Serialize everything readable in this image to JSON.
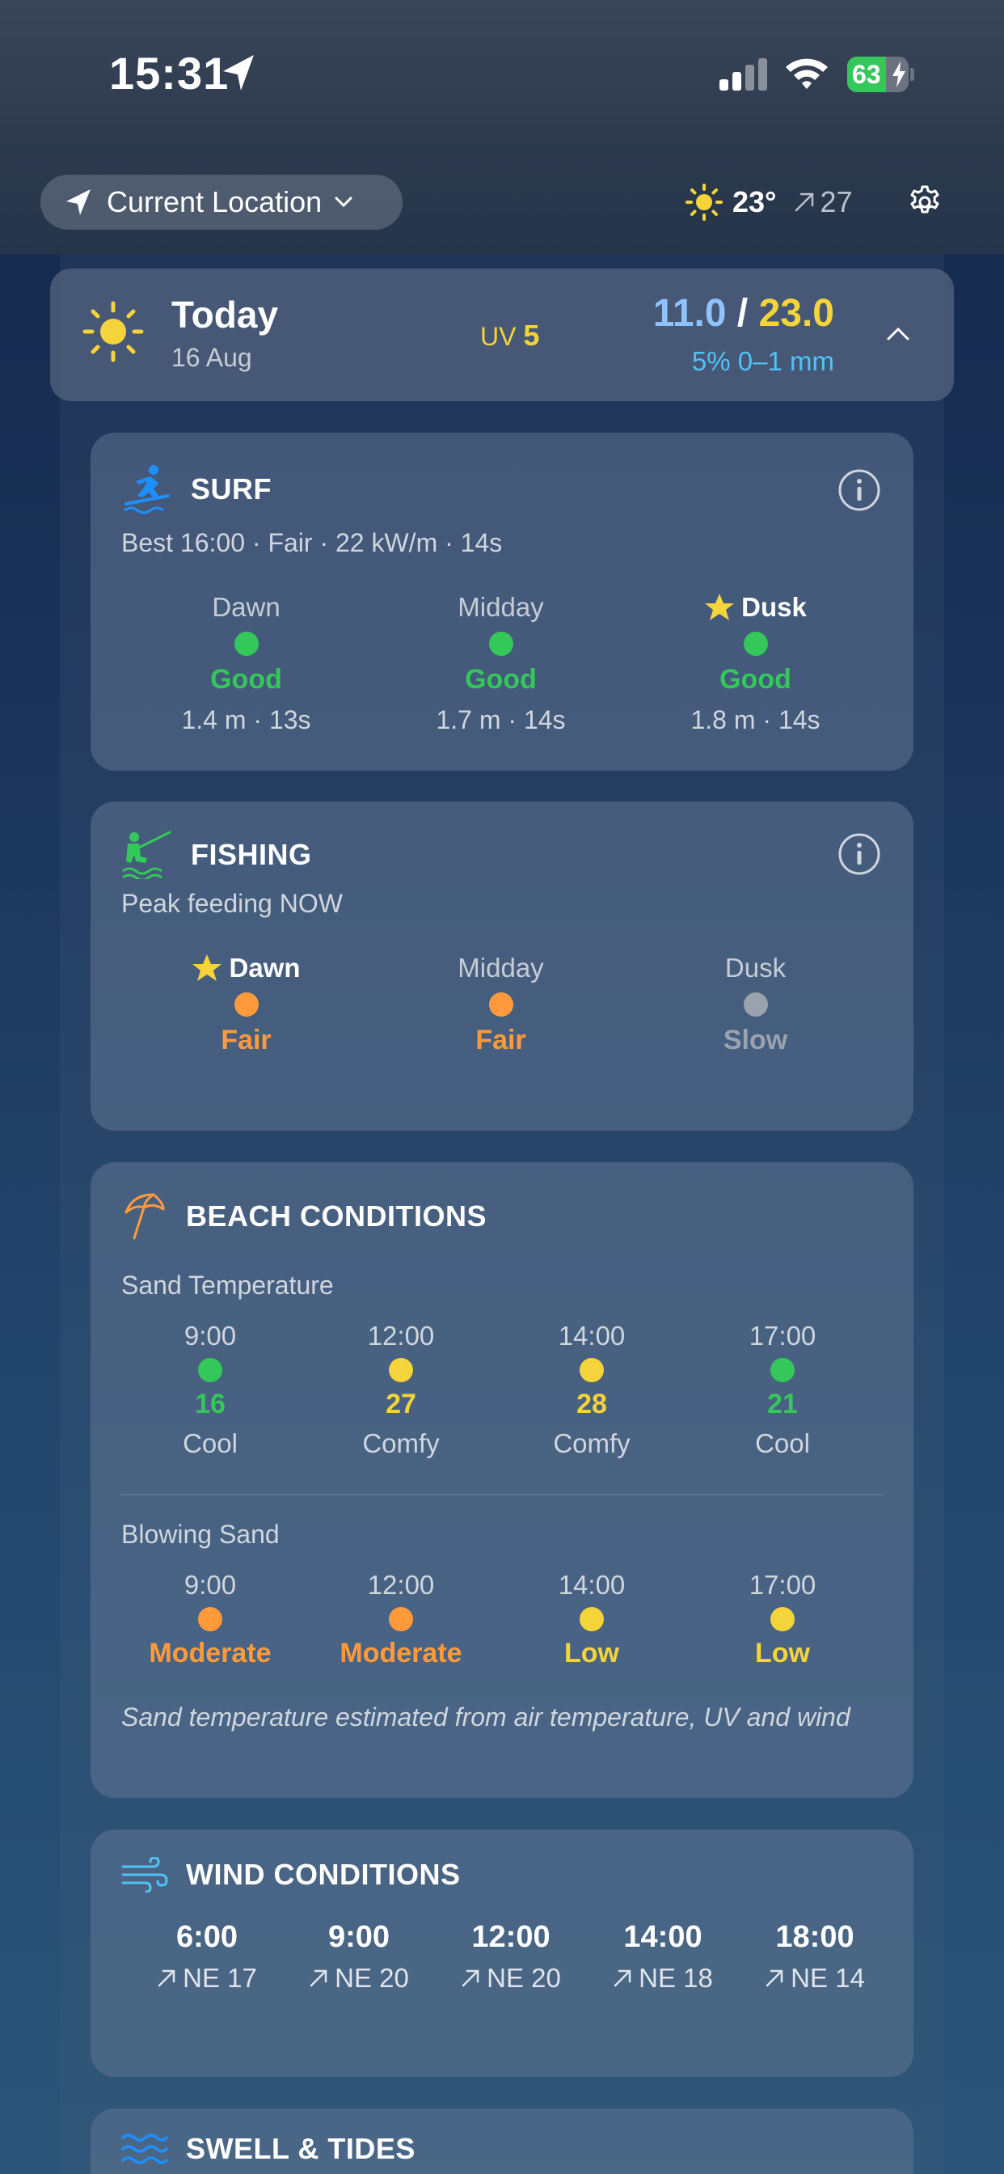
{
  "status_bar": {
    "time": "15:31",
    "battery": "63",
    "battery_level": 0.63
  },
  "header": {
    "location_label": "Current Location",
    "temperature": "23°",
    "wind_speed": "27"
  },
  "today": {
    "title": "Today",
    "date": "16 Aug",
    "uv_label": "UV",
    "uv_value": "5",
    "temp_low": "11.0",
    "temp_sep": "/",
    "temp_high": "23.0",
    "rain": "5% 0–1 mm"
  },
  "surf": {
    "title": "SURF",
    "summary": "Best 16:00 · Fair · 22 kW/m · 14s",
    "periods": [
      {
        "name": "Dawn",
        "starred": false,
        "rating": "Good",
        "color": "#34c759",
        "detail": "1.4 m · 13s"
      },
      {
        "name": "Midday",
        "starred": false,
        "rating": "Good",
        "color": "#34c759",
        "detail": "1.7 m · 14s"
      },
      {
        "name": "Dusk",
        "starred": true,
        "rating": "Good",
        "color": "#34c759",
        "detail": "1.8 m · 14s"
      }
    ]
  },
  "fishing": {
    "title": "FISHING",
    "summary": "Peak feeding NOW",
    "periods": [
      {
        "name": "Dawn",
        "starred": true,
        "rating": "Fair",
        "color": "#ff9a3c"
      },
      {
        "name": "Midday",
        "starred": false,
        "rating": "Fair",
        "color": "#ff9a3c"
      },
      {
        "name": "Dusk",
        "starred": false,
        "rating": "Slow",
        "color": "#9aa2ae"
      }
    ]
  },
  "beach": {
    "title": "BEACH CONDITIONS",
    "sand_temp_label": "Sand Temperature",
    "sand_temps": [
      {
        "time": "9:00",
        "value": "16",
        "desc": "Cool",
        "color": "#34c759"
      },
      {
        "time": "12:00",
        "value": "27",
        "desc": "Comfy",
        "color": "#f5d33a"
      },
      {
        "time": "14:00",
        "value": "28",
        "desc": "Comfy",
        "color": "#f5d33a"
      },
      {
        "time": "17:00",
        "value": "21",
        "desc": "Cool",
        "color": "#34c759"
      }
    ],
    "blowing_sand_label": "Blowing Sand",
    "blowing_sand": [
      {
        "time": "9:00",
        "value": "Moderate",
        "color": "#ff9a3c"
      },
      {
        "time": "12:00",
        "value": "Moderate",
        "color": "#ff9a3c"
      },
      {
        "time": "14:00",
        "value": "Low",
        "color": "#f5d33a"
      },
      {
        "time": "17:00",
        "value": "Low",
        "color": "#f5d33a"
      }
    ],
    "note": "Sand temperature estimated from air temperature, UV and wind"
  },
  "wind": {
    "title": "WIND CONDITIONS",
    "times": [
      {
        "time": "6:00",
        "value": "NE 17"
      },
      {
        "time": "9:00",
        "value": "NE 20"
      },
      {
        "time": "12:00",
        "value": "NE 20"
      },
      {
        "time": "14:00",
        "value": "NE 18"
      },
      {
        "time": "18:00",
        "value": "NE 14"
      }
    ]
  },
  "swell": {
    "title": "SWELL & TIDES"
  },
  "colors": {
    "good": "#34c759",
    "fair": "#ff9a3c",
    "comfy": "#f5d33a",
    "slow": "#9aa2ae",
    "accent_blue": "#4fc3f7"
  }
}
